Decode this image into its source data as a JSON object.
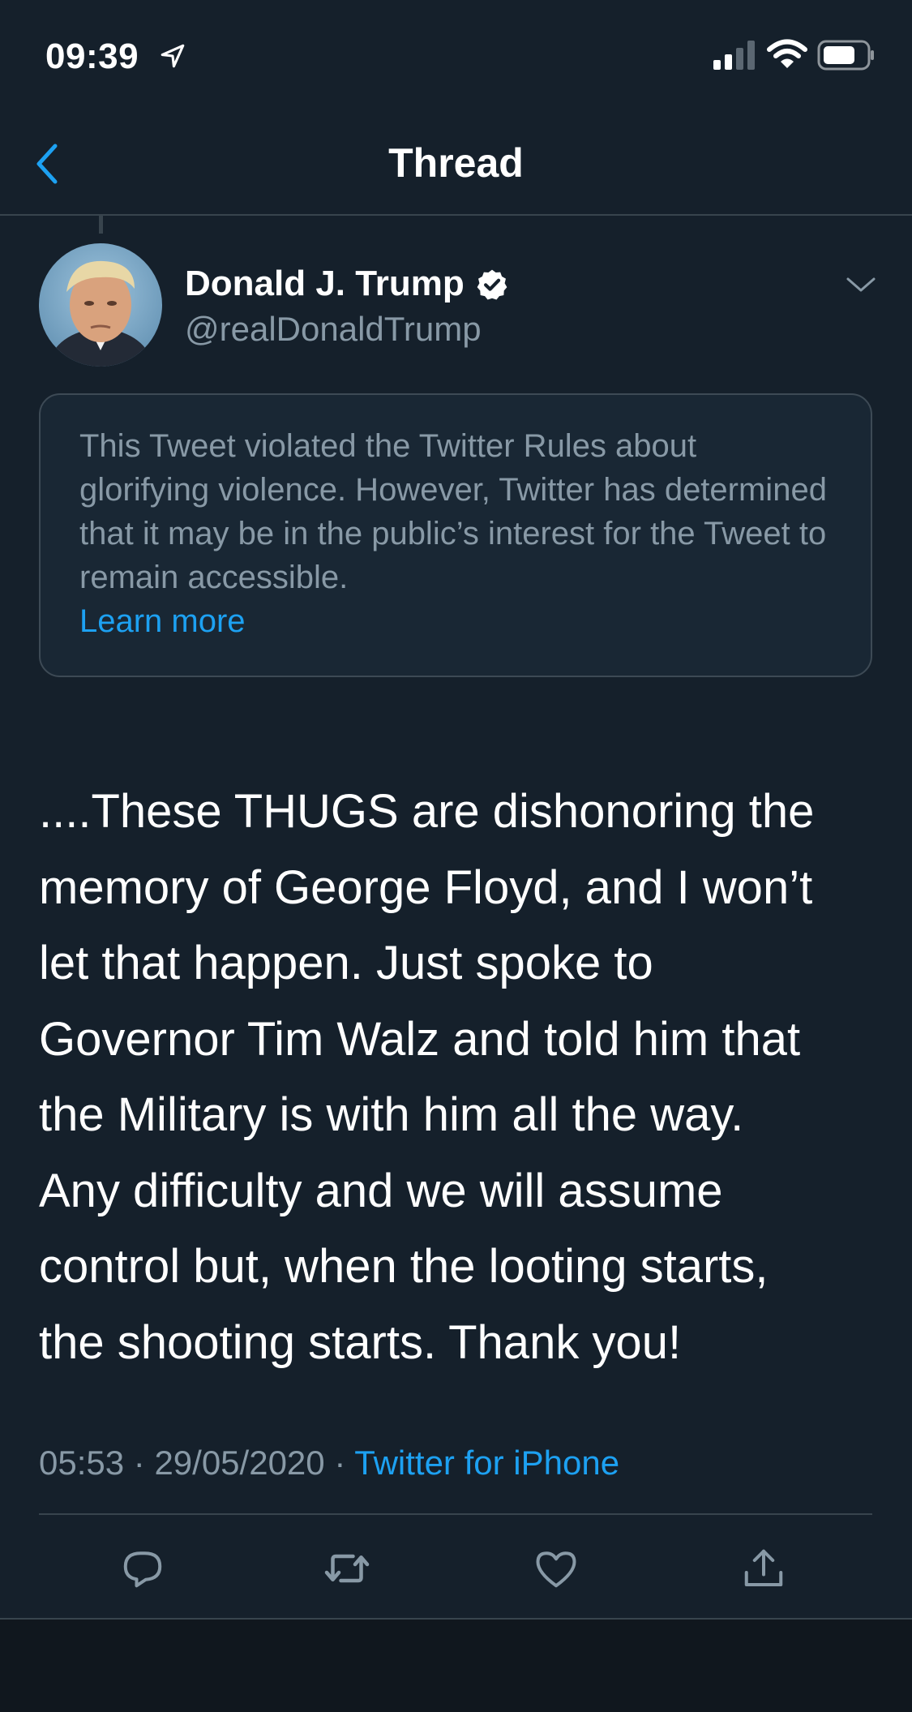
{
  "status_bar": {
    "time": "09:39",
    "icons": [
      "location-arrow-icon",
      "cellular-signal-icon",
      "wifi-icon",
      "battery-icon"
    ]
  },
  "nav": {
    "title": "Thread",
    "back_icon": "chevron-left-icon"
  },
  "author": {
    "name": "Donald J. Trump",
    "handle": "@realDonaldTrump",
    "verified_icon": "verified-badge-icon",
    "menu_icon": "chevron-down-icon"
  },
  "notice": {
    "text": "This Tweet violated the Twitter Rules about glorifying violence. However, Twitter has determined that it may be in the public’s interest for the Tweet to remain accessible.",
    "link": "Learn more"
  },
  "tweet": {
    "text": "....These THUGS are dishonoring the\nmemory of George Floyd, and I won’t\nlet that happen. Just spoke to\nGovernor Tim Walz and told him that\nthe Military is with him all the way.\nAny difficulty and we will assume\ncontrol but, when the looting starts,\nthe shooting starts. Thank you!",
    "time": "05:53",
    "separator": " · ",
    "date": "29/05/2020",
    "source": "Twitter for iPhone"
  },
  "actions": [
    "reply-icon",
    "retweet-icon",
    "like-icon",
    "share-icon"
  ],
  "colors": {
    "background": "#15202b",
    "accent": "#1da1f2",
    "secondary_text": "#8899a6",
    "divider": "#38444d"
  }
}
